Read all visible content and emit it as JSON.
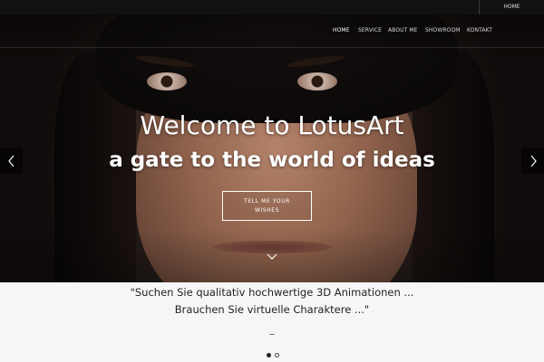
{
  "topbar": {
    "home_label": "HOME"
  },
  "nav": {
    "items": [
      {
        "label": "HOME",
        "active": true
      },
      {
        "label": "SERVICE",
        "active": false
      },
      {
        "label": "ABOUT ME",
        "active": false
      },
      {
        "label": "SHOWROOM",
        "active": false
      },
      {
        "label": "KONTAKT",
        "active": false
      }
    ]
  },
  "hero": {
    "title": "Welcome to LotusArt",
    "subtitle": "a gate to the world of ideas",
    "cta_label": "TELL ME YOUR WISHES"
  },
  "quote": {
    "line1": "\"Suchen Sie qualitativ hochwertige 3D Animationen ...",
    "line2": "Brauchen Sie virtuelle Charaktere ...\""
  },
  "slider": {
    "active_index": 1,
    "count": 2
  },
  "icons": {
    "prev": "chevron-left-icon",
    "next": "chevron-right-icon",
    "scroll": "chevron-down-icon"
  }
}
